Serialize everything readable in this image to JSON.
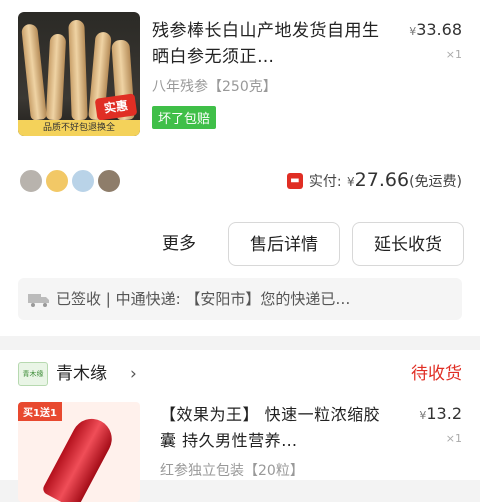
{
  "order1": {
    "product": {
      "title": "残参棒长白山产地发货自用生晒白参无须正…",
      "price_currency": "¥",
      "price": "33.68",
      "quantity": "×1",
      "spec": "八年残参【250克】",
      "tag": "坏了包赔",
      "image": {
        "badge": "实惠",
        "footer": "品质不好包退换全"
      }
    },
    "payment": {
      "icon": "red-pay-icon",
      "label": "实付:",
      "currency": "¥",
      "amount": "27.66",
      "note": "(免运费)"
    },
    "actions": {
      "more": "更多",
      "after_sales": "售后详情",
      "extend_receipt": "延长收货"
    },
    "logistics": {
      "icon": "truck-icon",
      "text": "已签收 | 中通快递: 【安阳市】您的快递已…"
    },
    "avatar_colors": [
      "#b8b3ad",
      "#f2c866",
      "#b9d3e8",
      "#8e7d6a"
    ]
  },
  "order2": {
    "shop": {
      "logo_text": "青木缘",
      "name": "青木缘",
      "arrow": "›"
    },
    "status": "待收货",
    "product": {
      "title": "【效果为王】 快速一粒浓缩胶囊 持久男性营养…",
      "price_currency": "¥",
      "price": "13.2",
      "quantity": "×1",
      "spec": "红参独立包装【20粒】",
      "image": {
        "ribbon": "买1送1"
      }
    }
  },
  "colors": {
    "accent_red": "#e02e24",
    "tag_green": "#3fbf48"
  }
}
